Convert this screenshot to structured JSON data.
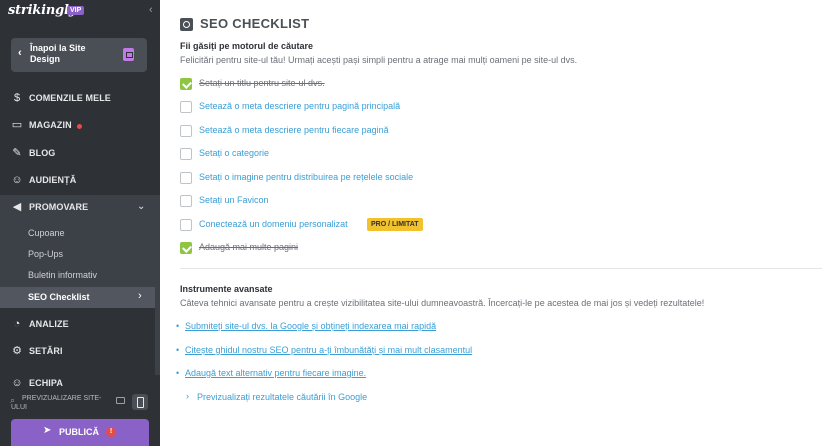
{
  "app": {
    "logo": "strikingly",
    "vip_badge": "VIP",
    "collapse_glyph": "‹"
  },
  "sidebar": {
    "back_label": "Înapoi la Site Design",
    "items": [
      {
        "label": "COMENZILE MELE",
        "icon": "dollar-icon",
        "glyph": "$"
      },
      {
        "label": "MAGAZIN",
        "icon": "store-icon",
        "glyph": "▭",
        "has_dot": true
      },
      {
        "label": "BLOG",
        "icon": "pen-icon",
        "glyph": "✎"
      },
      {
        "label": "AUDIENȚĂ",
        "icon": "people-icon",
        "glyph": "☺"
      },
      {
        "label": "PROMOVARE",
        "icon": "megaphone-icon",
        "glyph": "◀",
        "expanded": true
      },
      {
        "label": "ANALIZE",
        "icon": "chart-icon",
        "glyph": "◔"
      },
      {
        "label": "SETĂRI",
        "icon": "gear-icon",
        "glyph": "⚙"
      },
      {
        "label": "ECHIPA",
        "icon": "team-icon",
        "glyph": "☺"
      }
    ],
    "promo_sub_items": [
      "Cupoane",
      "Pop-Ups",
      "Buletin informativ",
      "SEO Checklist"
    ],
    "active_sub_item": "SEO Checklist",
    "preview_label": "PREVIZUALIZARE SITE-ULUI",
    "publish_label": "PUBLICĂ",
    "publish_warning": "!"
  },
  "main": {
    "title": "SEO CHECKLIST",
    "section1": {
      "heading": "Fii găsiți pe motorul de căutare",
      "description": "Felicitări pentru site-ul tău! Urmați acești pași simpli pentru a atrage mai mulți oameni pe site-ul dvs.",
      "items": [
        {
          "label": "Setați un titlu pentru site-ul dvs.",
          "checked": true
        },
        {
          "label": "Setează o meta descriere pentru pagină principală",
          "checked": false
        },
        {
          "label": "Setează o meta descriere pentru fiecare pagină",
          "checked": false
        },
        {
          "label": "Setați o categorie",
          "checked": false
        },
        {
          "label": "Setați o imagine pentru distribuirea pe rețelele sociale",
          "checked": false
        },
        {
          "label": "Setați un Favicon",
          "checked": false
        },
        {
          "label": "Conectează un domeniu personalizat",
          "checked": false,
          "badge": "PRO / LIMITAT"
        },
        {
          "label": "Adaugă mai multe pagini",
          "checked": true
        }
      ]
    },
    "section2": {
      "heading": "Instrumente avansate",
      "description": "Câteva tehnici avansate pentru a crește vizibilitatea site-ului dumneavoastră. Încercați-le pe acestea de mai jos și vedeți rezultatele!",
      "links": [
        "Submiteți site-ul dvs. la Google și obțineți indexarea mai rapidă",
        "Citește ghidul nostru SEO pentru a-ți îmbunătăți și mai mult clasamentul",
        "Adaugă text alternativ pentru fiecare imagine."
      ],
      "preview_results": "Previzualizați rezultatele căutării în Google"
    }
  },
  "colors": {
    "sidebar_bg": "#2e3136",
    "accent": "#8a61c6",
    "link": "#3a9fd6",
    "check_green": "#8fc63f",
    "badge_yellow": "#f2c12e"
  }
}
